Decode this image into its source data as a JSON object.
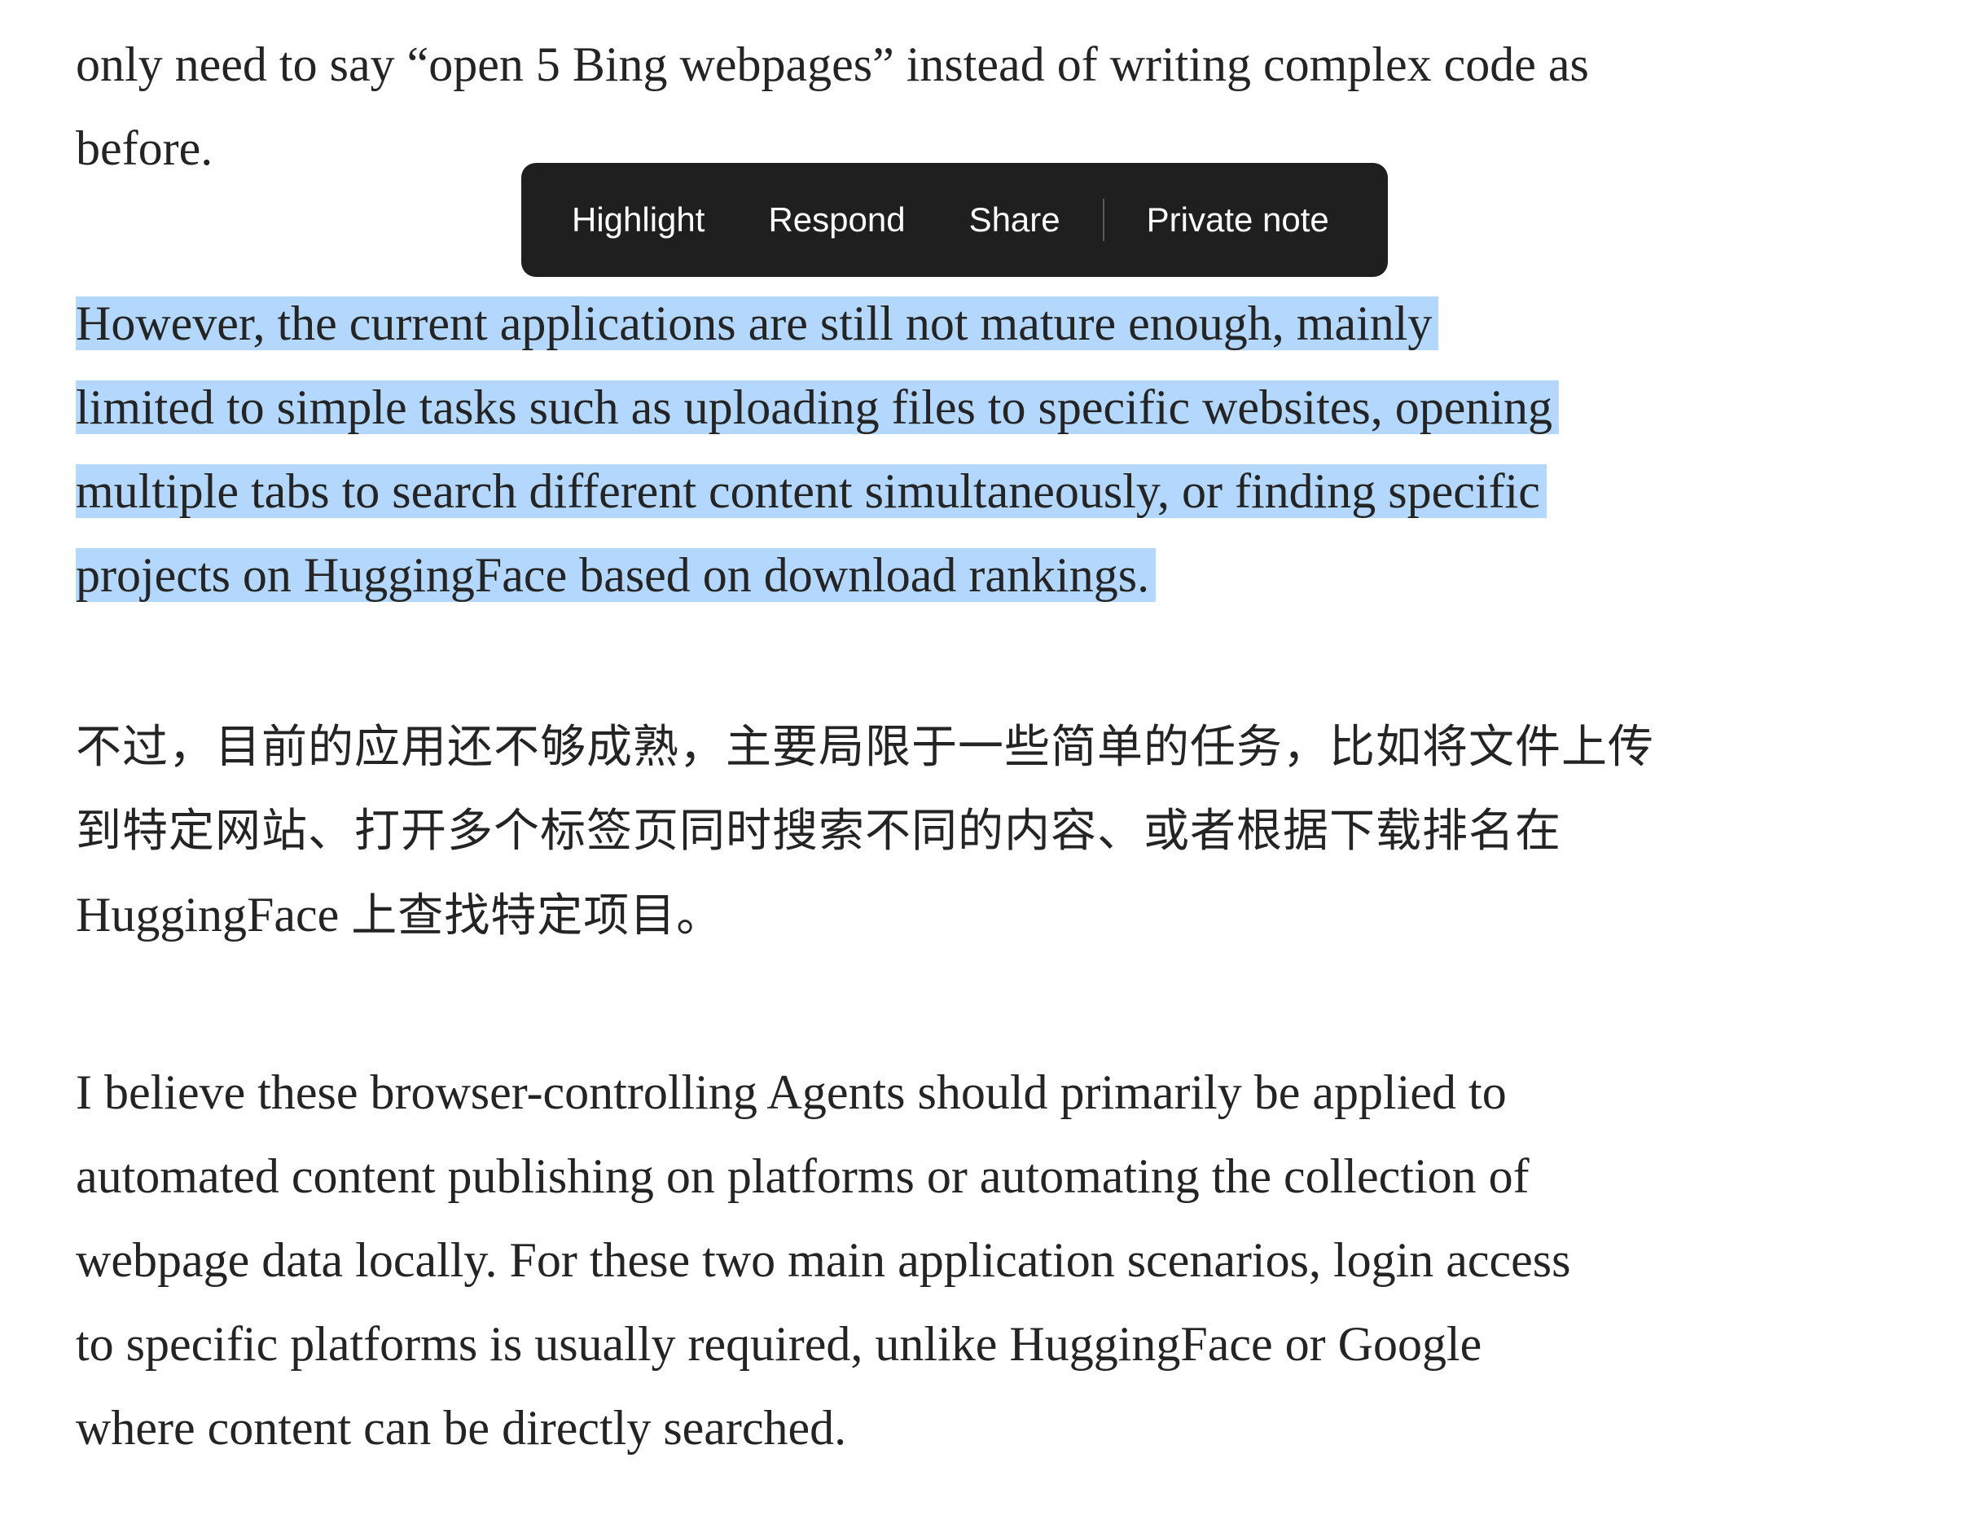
{
  "article": {
    "paragraph_top_partial": [
      "only need to say “open 5 Bing webpages” instead of writing complex code as",
      "before."
    ],
    "paragraph_selected": [
      "However, the current applications are still not mature enough, mainly",
      "limited to simple tasks such as uploading files to specific websites, opening",
      "multiple tabs to search different content simultaneously, or finding specific",
      "projects on HuggingFace based on download rankings."
    ],
    "paragraph_chinese": {
      "line1": "不过，目前的应用还不够成熟，主要局限于一些简单的任务，比如将文件上传",
      "line2": "到特定网站、打开多个标签页同时搜索不同的内容、或者根据下载排名在",
      "line3_latin": "HuggingFace ",
      "line3_rest": "上查找特定项目。"
    },
    "paragraph_last": [
      "I believe these browser-controlling Agents should primarily be applied to",
      "automated content publishing on platforms or automating the collection of",
      "webpage data locally. For these two main application scenarios, login access",
      "to specific platforms is usually required, unlike HuggingFace or Google",
      "where content can be directly searched."
    ]
  },
  "toolbar": {
    "highlight_label": "Highlight",
    "respond_label": "Respond",
    "share_label": "Share",
    "private_note_label": "Private note"
  },
  "colors": {
    "selection": "#b3d7fd",
    "toolbar_bg": "#1f1f1f",
    "text": "#242424"
  }
}
